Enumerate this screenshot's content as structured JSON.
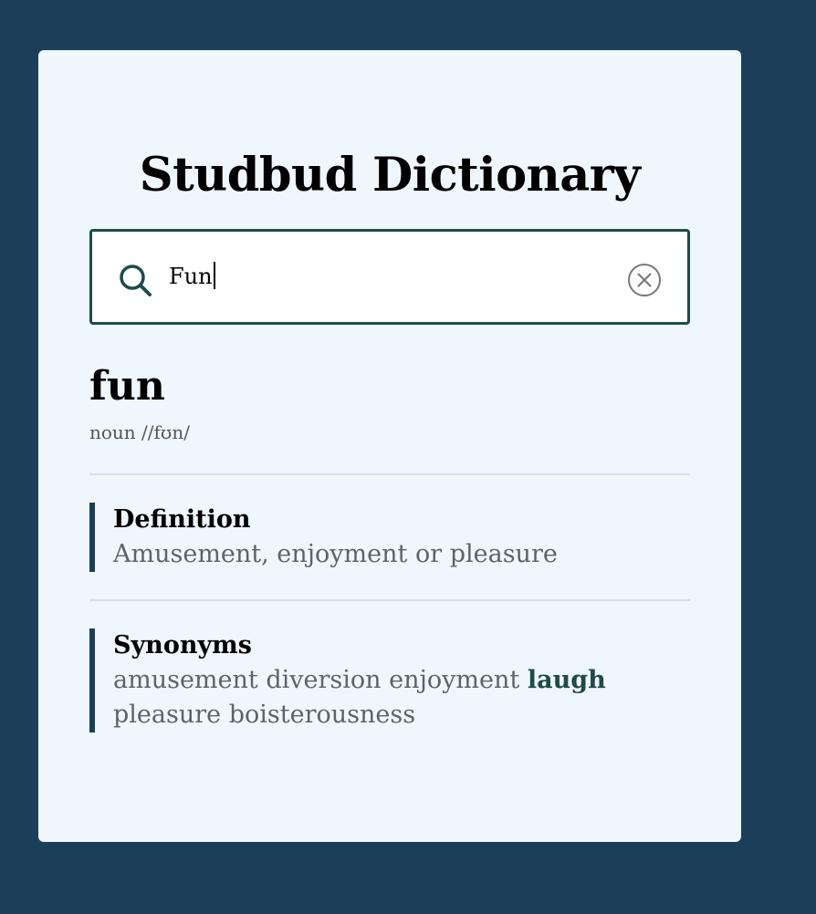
{
  "app": {
    "title": "Studbud Dictionary"
  },
  "search": {
    "value": "Fun",
    "search_icon": "search-icon",
    "clear_icon": "clear-icon"
  },
  "entry": {
    "word": "fun",
    "part_of_speech": "noun //fʊn/"
  },
  "definition": {
    "heading": "Definition",
    "text": "Amusement, enjoyment or pleasure"
  },
  "synonyms": {
    "heading": "Synonyms",
    "items": [
      {
        "text": "amusement",
        "highlighted": false
      },
      {
        "text": "diversion",
        "highlighted": false
      },
      {
        "text": "enjoyment",
        "highlighted": false
      },
      {
        "text": "laugh",
        "highlighted": true
      },
      {
        "text": "pleasure",
        "highlighted": false
      },
      {
        "text": "boisterousness",
        "highlighted": false
      }
    ]
  },
  "colors": {
    "page_background": "#1b3f59",
    "card_background": "#eff6fc",
    "accent": "#1f4a4a",
    "section_bar": "#1b3f59",
    "muted_text": "#5f6368"
  }
}
